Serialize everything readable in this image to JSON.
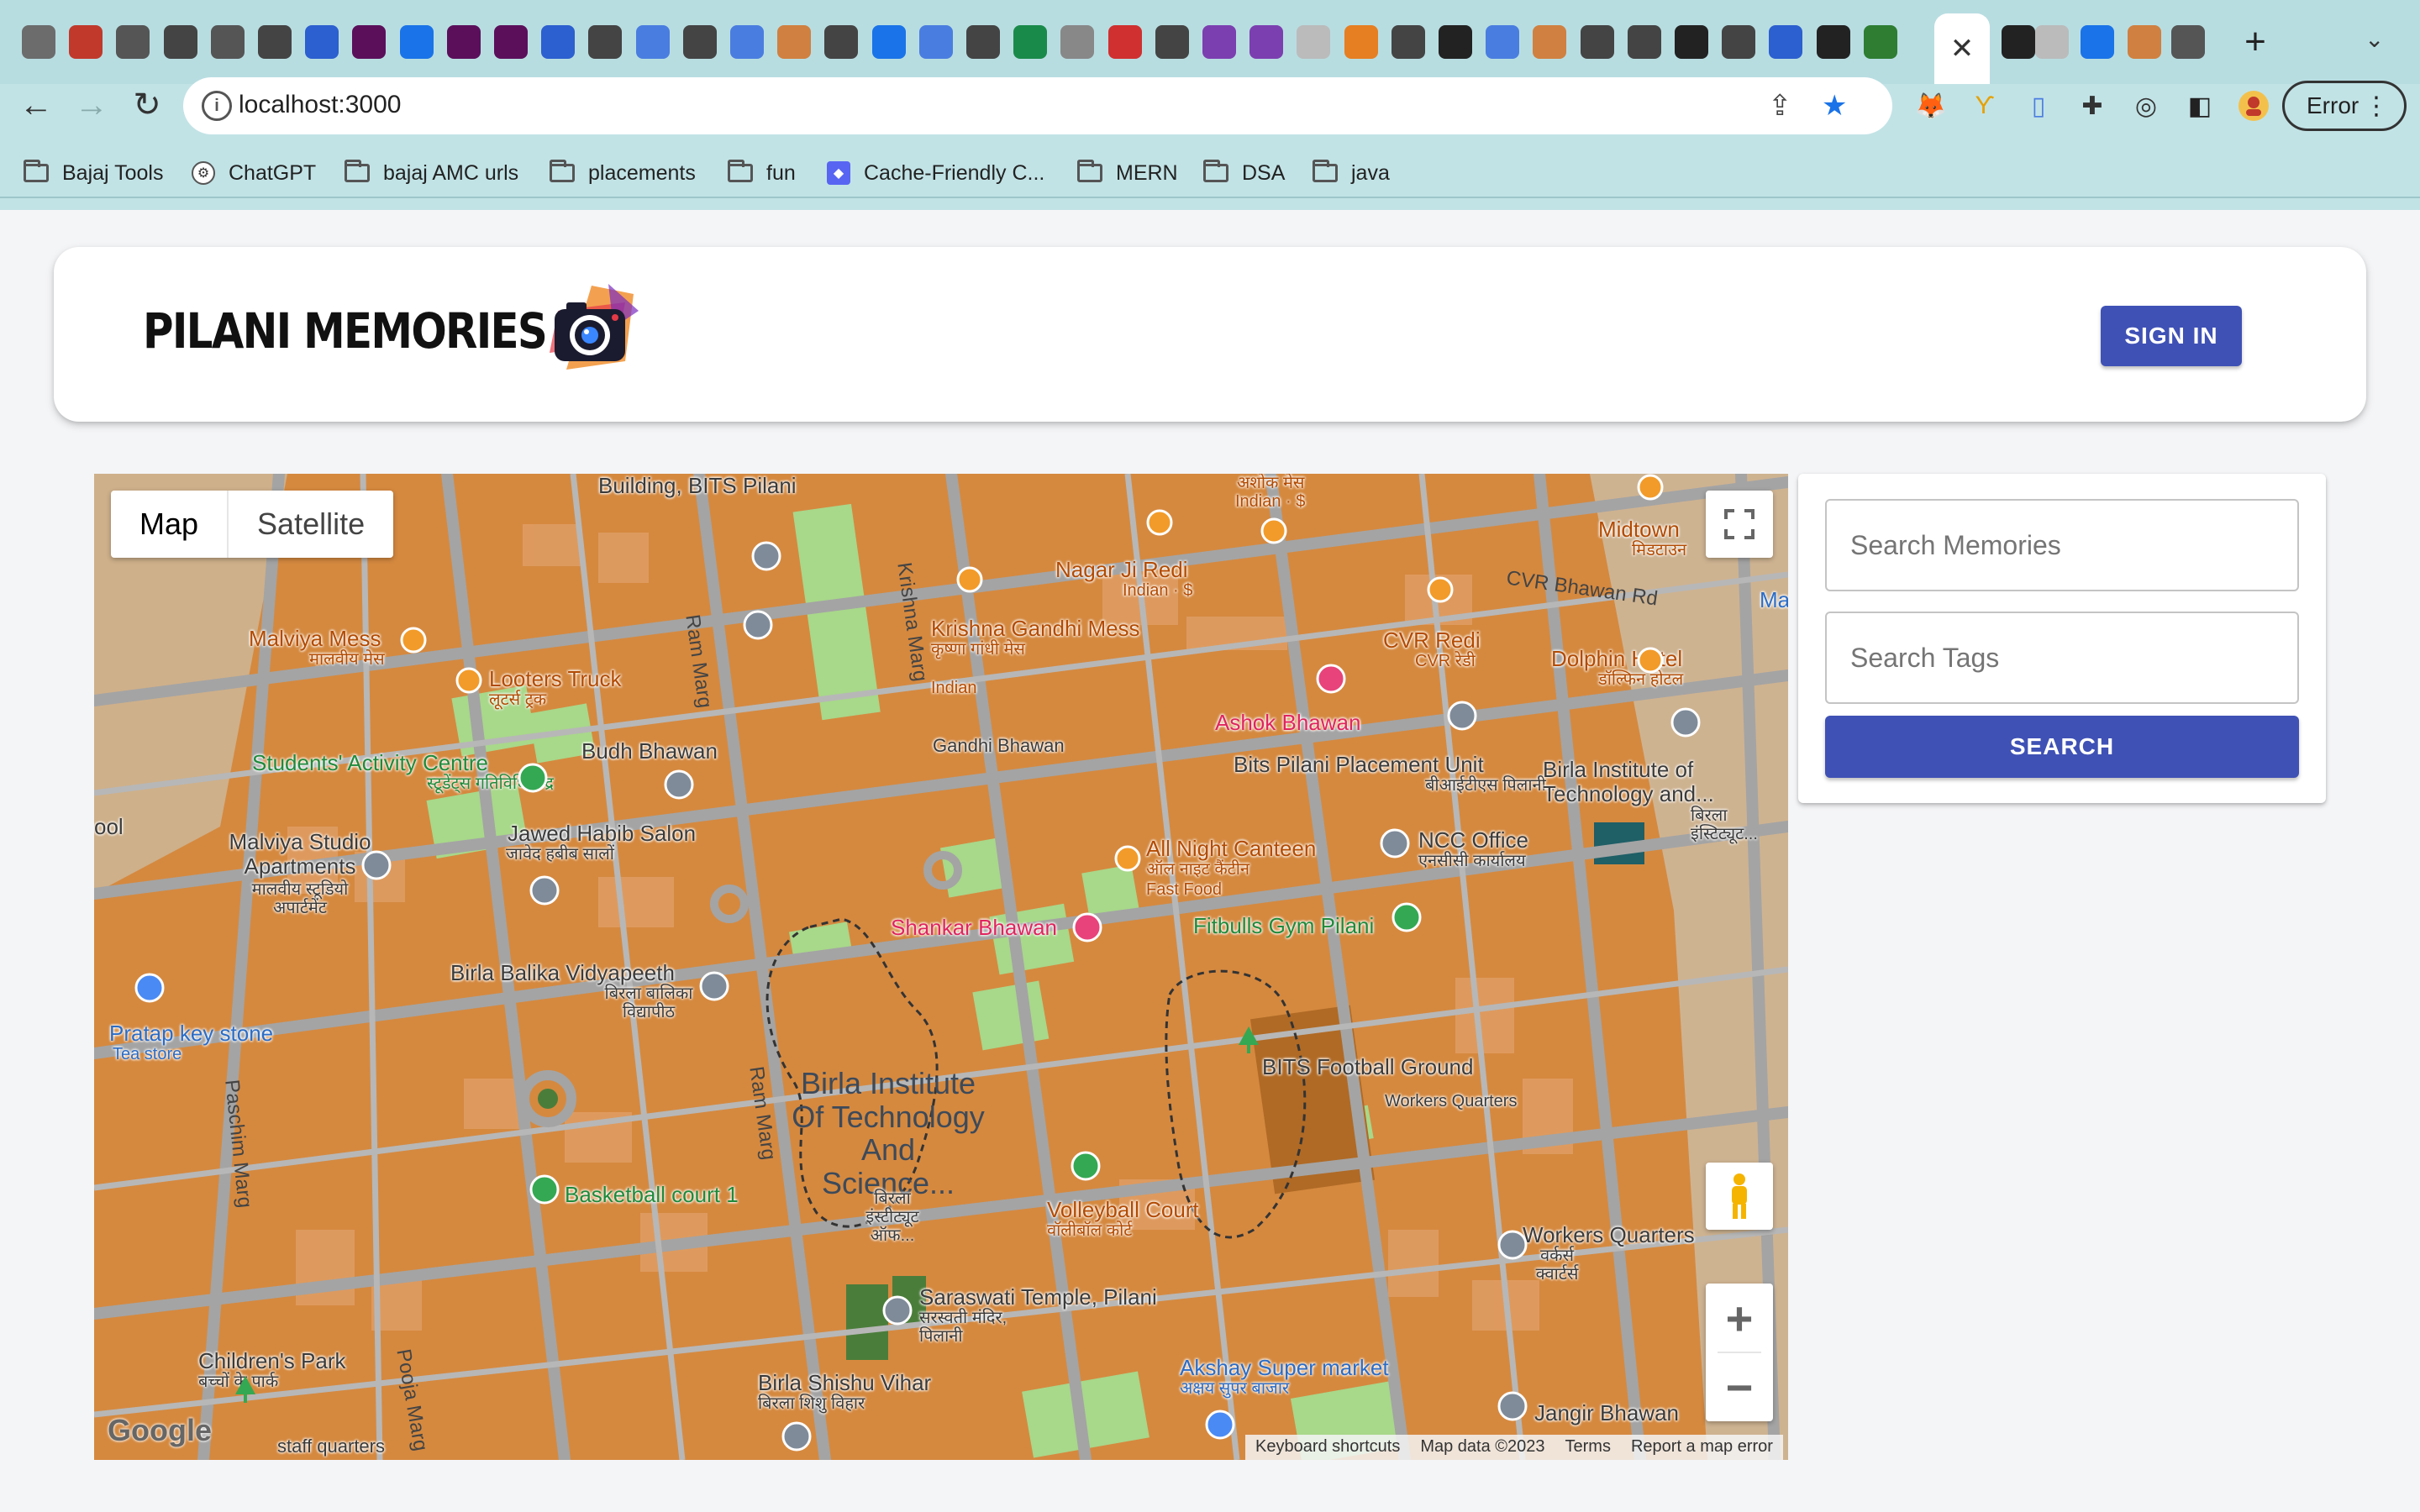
{
  "browser": {
    "active_tab_close": "✕",
    "new_tab": "+",
    "url": "localhost:3000",
    "profile_status": "Error",
    "bookmarks": [
      "Bajaj Tools",
      "ChatGPT",
      "bajaj AMC urls",
      "placements",
      "fun",
      "Cache-Friendly C...",
      "MERN",
      "DSA",
      "java"
    ]
  },
  "header": {
    "brand": "PILANI MEMORIES",
    "signin_label": "SIGN IN"
  },
  "map": {
    "type_options": [
      "Map",
      "Satellite"
    ],
    "selected_type": "Map",
    "places": {
      "building_bits": "Building, BITS Pilani",
      "ashok_mess": "अशोक मेस",
      "indian_price": "Indian · $",
      "midtown": "Midtown",
      "midtown_hi": "मिडटाउन",
      "nagar_ji_redi": "Nagar Ji Redi",
      "nagar_ji_sub": "Indian · $",
      "cvr_bhawan_rd": "CVR Bhawan Rd",
      "malviya_mess": "Malviya Mess",
      "malviya_mess_hi": "मालवीय मेस",
      "krishna_gandhi_mess": "Krishna Gandhi Mess",
      "krishna_gandhi_hi": "कृष्णा गांधी मेस",
      "krishna_gandhi_sub": "Indian",
      "cvr_redi": "CVR Redi",
      "cvr_redi_hi": "CVR रेडी",
      "dolphin_hotel": "Dolphin Hotel",
      "dolphin_hotel_hi": "डॉल्फिन होटल",
      "looters_truck": "Looters Truck",
      "looters_truck_hi": "लूटर्स ट्रक",
      "gandhi_bhawan": "Gandhi Bhawan",
      "ashok_bhawan": "Ashok Bhawan",
      "budh_bhawan": "Budh Bhawan",
      "students_activity": "Students' Activity Centre",
      "students_activity_hi": "स्टूडेंट्स गतिविधि केंद्र",
      "placement_unit": "Bits Pilani Placement Unit",
      "placement_unit_hi": "बीआईटीएस पिलानी...",
      "birla_institute_tech": "Birla Institute of Technology and...",
      "birla_institute_hi": "बिरला इंस्टिट्यूट...",
      "ool": "ool",
      "malviya_studio": "Malviya Studio Apartments",
      "malviya_studio_hi": "मालवीय स्टूडियो अपार्टमेंट",
      "jawed_habib": "Jawed Habib Salon",
      "jawed_habib_hi": "जावेद हबीब सालों",
      "all_night_canteen": "All Night Canteen",
      "all_night_canteen_hi": "ऑल नाइट कैंटीन",
      "all_night_canteen_sub": "Fast Food",
      "ncc_office": "NCC Office",
      "ncc_office_hi": "एनसीसी कार्यालय",
      "shankar_bhawan": "Shankar Bhawan",
      "fitbulls_gym": "Fitbulls Gym Pilani",
      "birla_balika": "Birla Balika Vidyapeeth",
      "birla_balika_hi": "बिरला बालिका विद्यापीठ",
      "pratap_key_stone": "Pratap key stone",
      "pratap_key_stone_sub": "Tea store",
      "birla_institute_center": "Birla Institute Of Technology And Science...",
      "birla_institute_center_hi": "बिरला इंस्टीट्यूट ऑफ...",
      "bits_football": "BITS Football Ground",
      "workers_quarters_1": "Workers Quarters",
      "basketball_court": "Basketball court 1",
      "volleyball_court": "Volleyball Court",
      "volleyball_court_hi": "वॉलीबॉल कोर्ट",
      "workers_quarters_2": "Workers Quarters",
      "workers_quarters_2_hi": "वर्कर्स क्वार्टर्स",
      "saraswati_temple": "Saraswati Temple, Pilani",
      "saraswati_temple_hi": "सरस्वती मंदिर, पिलानी",
      "childrens_park": "Children's Park",
      "childrens_park_hi": "बच्चों के पार्क",
      "birla_shishu_vihar": "Birla Shishu Vihar",
      "birla_shishu_vihar_hi": "बिरला शिशु विहार",
      "akshay_super_market": "Akshay Super market",
      "akshay_super_market_hi": "अक्षय सुपर बाजार",
      "jangir_bhawan": "Jangir Bhawan",
      "staff_quarters": "staff quarters",
      "ram_marg": "Ram Marg",
      "krishna_marg": "Krishna Marg",
      "paschim_marg": "Paschim Marg",
      "pooja_marg": "Pooja Marg",
      "ma": "Ma"
    },
    "google_logo": "Google",
    "attribution": [
      "Keyboard shortcuts",
      "Map data ©2023",
      "Terms",
      "Report a map error"
    ]
  },
  "search_panel": {
    "memories_placeholder": "Search Memories",
    "tags_placeholder": "Search Tags",
    "search_label": "SEARCH"
  },
  "colors": {
    "primary": "#3f51b5",
    "map_land": "#d5893f",
    "map_park": "#a8d88a",
    "map_road": "#a4a4a4"
  }
}
